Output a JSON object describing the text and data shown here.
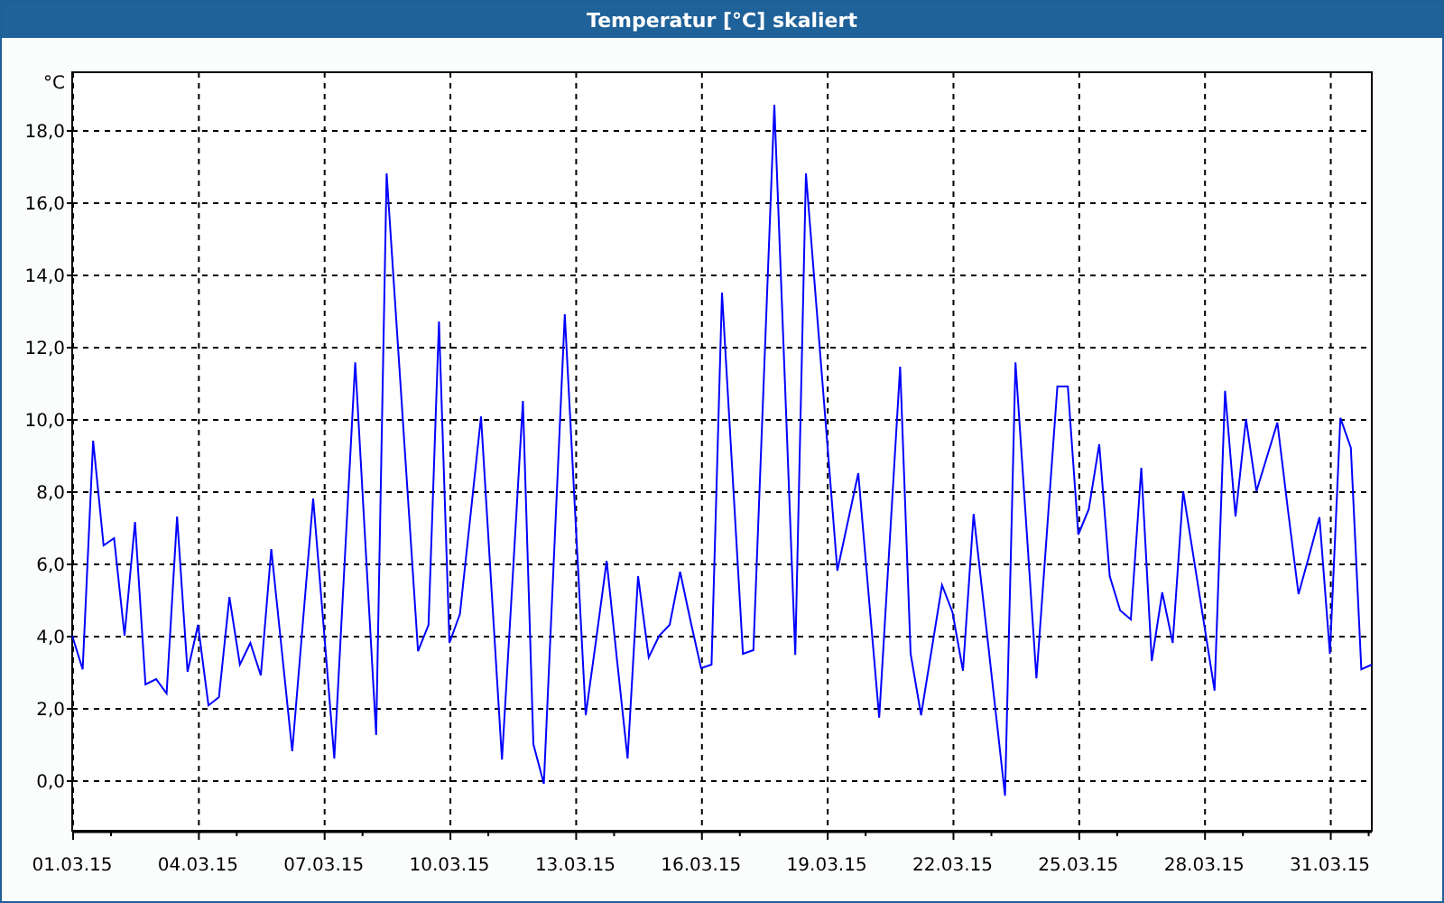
{
  "window": {
    "title": "Temperatur [°C] skaliert"
  },
  "chart": {
    "chart_data": {
      "type": "line",
      "grid": true,
      "ylabel": "°C",
      "ylim": [
        -1.4,
        19.6
      ],
      "categories": [
        "01.03.15",
        null,
        null,
        null,
        null,
        null,
        null,
        null,
        null,
        null,
        null,
        null,
        "04.03.15",
        null,
        null,
        null,
        null,
        null,
        null,
        null,
        null,
        null,
        null,
        null,
        "07.03.15",
        null,
        null,
        null,
        null,
        null,
        null,
        null,
        null,
        null,
        null,
        null,
        "10.03.15",
        null,
        null,
        null,
        null,
        null,
        null,
        null,
        null,
        null,
        null,
        null,
        "13.03.15",
        null,
        null,
        null,
        null,
        null,
        null,
        null,
        null,
        null,
        null,
        null,
        "16.03.15",
        null,
        null,
        null,
        null,
        null,
        null,
        null,
        null,
        null,
        null,
        null,
        "19.03.15",
        null,
        null,
        null,
        null,
        null,
        null,
        null,
        null,
        null,
        null,
        null,
        "22.03.15",
        null,
        null,
        null,
        null,
        null,
        null,
        null,
        null,
        null,
        null,
        null,
        "25.03.15",
        null,
        null,
        null,
        null,
        null,
        null,
        null,
        null,
        null,
        null,
        null,
        "28.03.15",
        null,
        null,
        null,
        null,
        null,
        null,
        null,
        null,
        null,
        null,
        null,
        "31.03.15",
        null,
        null,
        null,
        null
      ],
      "yticks": [
        {
          "value": 0,
          "label": "0,0"
        },
        {
          "value": 2,
          "label": "2,0"
        },
        {
          "value": 4,
          "label": "4,0"
        },
        {
          "value": 6,
          "label": "6,0"
        },
        {
          "value": 8,
          "label": "8,0"
        },
        {
          "value": 10,
          "label": "10,0"
        },
        {
          "value": 12,
          "label": "12,0"
        },
        {
          "value": 14,
          "label": "14,0"
        },
        {
          "value": 16,
          "label": "16,0"
        },
        {
          "value": 18,
          "label": "18,0"
        }
      ],
      "series": [
        {
          "color": "#0000ff",
          "values": [
            4.0,
            3.07,
            9.4,
            6.5,
            6.7,
            4.0,
            7.15,
            2.65,
            2.8,
            2.4,
            7.3,
            3.0,
            4.3,
            2.07,
            2.3,
            5.07,
            3.2,
            3.8,
            2.9,
            6.4,
            3.6,
            0.8,
            4.3,
            7.8,
            4.2,
            0.6,
            6.1,
            11.57,
            6.4,
            1.25,
            16.8,
            12.39,
            7.98,
            3.57,
            4.3,
            12.7,
            3.8,
            4.6,
            7.3,
            10.07,
            5.3,
            0.57,
            5.5,
            10.5,
            1.0,
            -0.1,
            6.4,
            12.9,
            7.35,
            1.8,
            3.9,
            6.07,
            3.3,
            0.6,
            5.65,
            3.4,
            4.0,
            4.3,
            5.77,
            4.4,
            3.1,
            3.2,
            13.5,
            8.5,
            3.5,
            3.6,
            11.15,
            18.7,
            11.1,
            3.47,
            16.8,
            13.13,
            9.47,
            5.8,
            7.15,
            8.5,
            5.1,
            1.73,
            6.6,
            11.45,
            3.5,
            1.8,
            3.6,
            5.4,
            4.65,
            3.03,
            7.37,
            4.77,
            2.17,
            -0.43,
            11.57,
            7.2,
            2.82,
            6.86,
            10.9,
            10.9,
            6.8,
            7.5,
            9.3,
            5.65,
            4.7,
            4.45,
            8.65,
            3.3,
            5.2,
            3.8,
            8.0,
            6.16,
            4.32,
            2.48,
            10.78,
            7.3,
            10.0,
            8.0,
            8.95,
            9.9,
            7.5,
            5.15,
            6.2,
            7.28,
            3.5,
            10.03,
            9.2,
            3.07,
            3.2
          ]
        }
      ]
    }
  }
}
